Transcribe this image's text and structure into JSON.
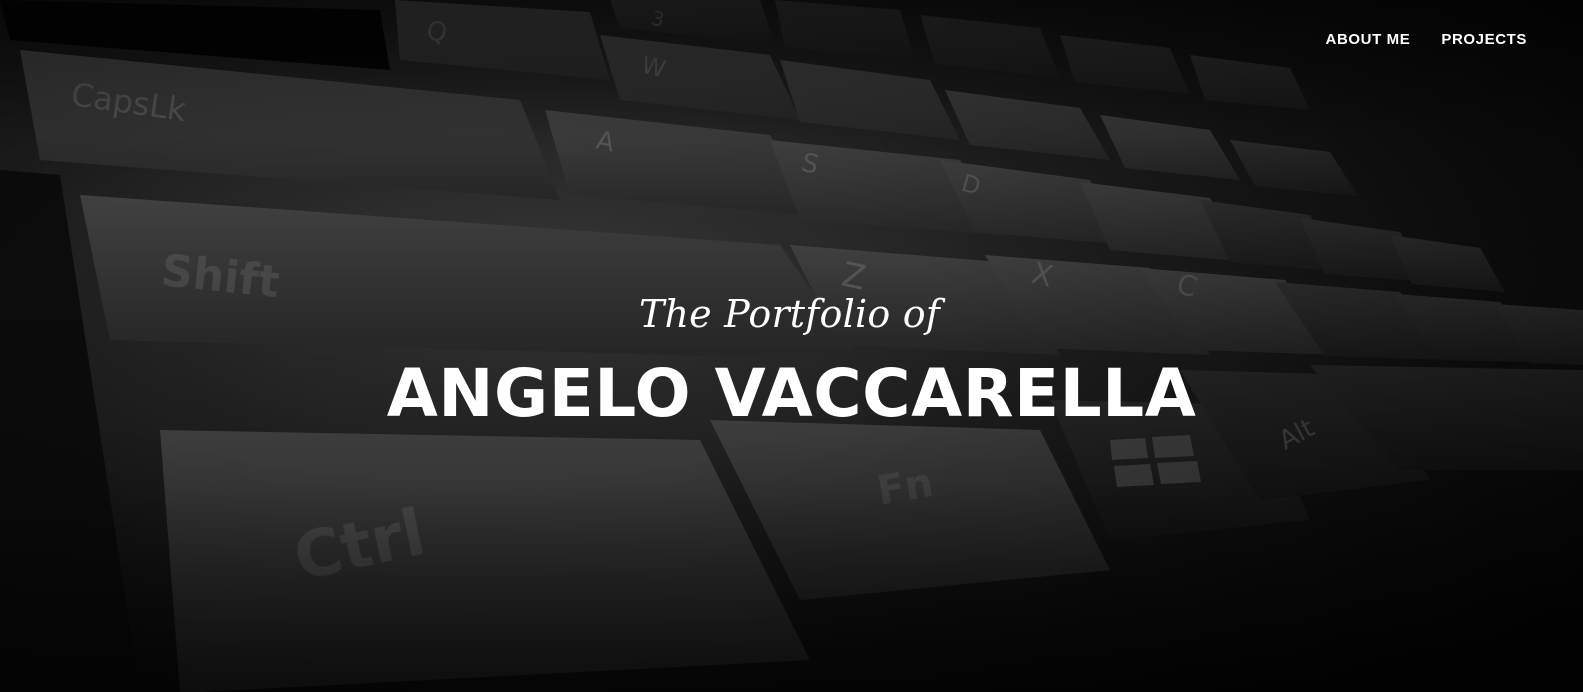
{
  "nav": {
    "items": [
      {
        "label": "ABOUT ME"
      },
      {
        "label": "PROJECTS"
      }
    ]
  },
  "hero": {
    "subtitle": "The Portfolio of",
    "title": "ANGELO VACCARELLA",
    "background_image": "keyboard-closeup-photo",
    "key_legends": [
      "Q",
      "W",
      "3",
      "CapsLk",
      "A",
      "S",
      "D",
      "Shift",
      "Z",
      "X",
      "C",
      "Ctrl",
      "Fn",
      "Alt"
    ]
  },
  "colors": {
    "text": "#ffffff",
    "background": "#0b0b0b"
  }
}
